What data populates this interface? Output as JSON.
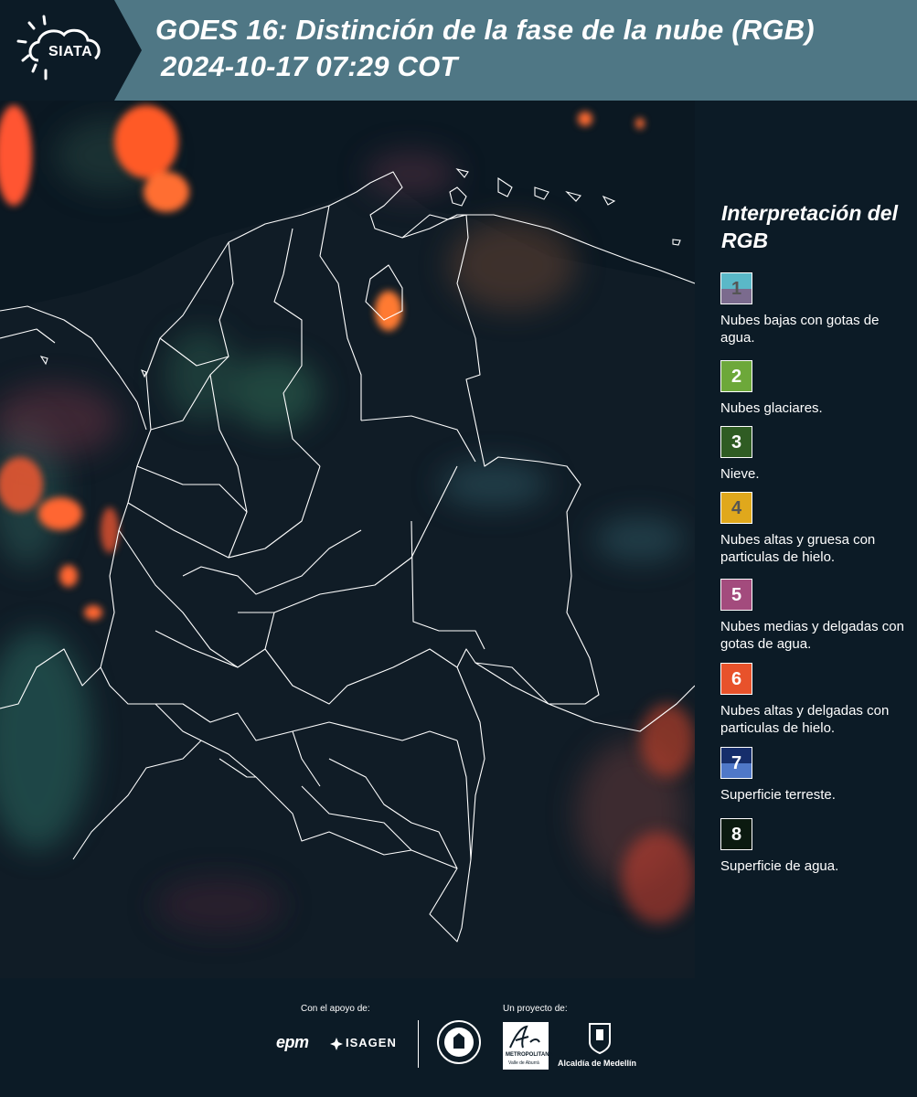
{
  "header": {
    "logo_text": "SIATA",
    "title_line1": "GOES 16: Distinción de la fase de la nube (RGB)",
    "title_line2": "2024-10-17 07:29 COT",
    "bg_color": "#4f7785"
  },
  "legend": {
    "title": "Interpretación del RGB",
    "items": [
      {
        "number": "1",
        "label": "Nubes bajas con gotas de agua.",
        "color_top": "#5ab8c8",
        "color_bottom": "#7b6b8e",
        "num_color": "#555555"
      },
      {
        "number": "2",
        "label": "Nubes glaciares.",
        "color_top": "#6da83a",
        "color_bottom": "#6da83a",
        "num_color": "#ffffff"
      },
      {
        "number": "3",
        "label": "Nieve.",
        "color_top": "#2f5c23",
        "color_bottom": "#2f5c23",
        "num_color": "#ffffff"
      },
      {
        "number": "4",
        "label": "Nubes altas y gruesa con particulas de hielo.",
        "color_top": "#e0a81c",
        "color_bottom": "#e0a81c",
        "num_color": "#555555"
      },
      {
        "number": "5",
        "label": "Nubes medias y delgadas con gotas de agua.",
        "color_top": "#a34b7d",
        "color_bottom": "#a34b7d",
        "num_color": "#ffffff"
      },
      {
        "number": "6",
        "label": "Nubes altas y delgadas con particulas de hielo.",
        "color_top": "#e8522b",
        "color_bottom": "#e8522b",
        "num_color": "#ffffff"
      },
      {
        "number": "7",
        "label": "Superficie terreste.",
        "color_top": "#162e6b",
        "color_bottom": "#4f78c8",
        "num_color": "#ffffff"
      },
      {
        "number": "8",
        "label": "Superficie de agua.",
        "color_top": "#0b1a10",
        "color_bottom": "#0b1a10",
        "num_color": "#ffffff"
      }
    ]
  },
  "footer": {
    "support_caption": "Con el apoyo de:",
    "project_caption": "Un proyecto de:",
    "epm_logo_text": "epm",
    "isagen_logo_text": "ISAGEN",
    "metropolitana_logo_text": "METROPOLITANA",
    "metropolitana_sub_text": "Valle de Aburrá",
    "alcaldia_logo_text": "Alcaldía de Medellín"
  }
}
